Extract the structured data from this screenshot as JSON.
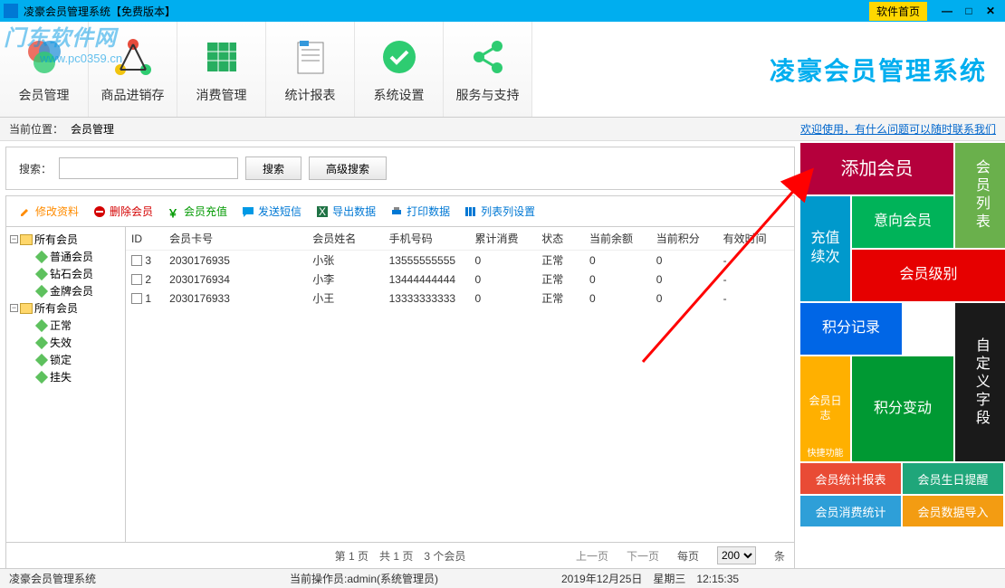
{
  "titlebar": {
    "title": "凌豪会员管理系统【免费版本】",
    "home": "软件首页"
  },
  "watermark": {
    "text": "门东软件网",
    "url": "www.pc0359.cn"
  },
  "toolbar": [
    {
      "label": "会员管理",
      "name": "member-manage"
    },
    {
      "label": "商品进销存",
      "name": "inventory"
    },
    {
      "label": "消费管理",
      "name": "consume"
    },
    {
      "label": "统计报表",
      "name": "report"
    },
    {
      "label": "系统设置",
      "name": "settings"
    },
    {
      "label": "服务与支持",
      "name": "support"
    }
  ],
  "brand": "凌豪会员管理系统",
  "breadcrumb": {
    "label": "当前位置：",
    "path": "会员管理"
  },
  "welcome": "欢迎使用，有什么问题可以随时联系我们",
  "search": {
    "label": "搜索：",
    "btn_search": "搜索",
    "btn_adv": "高级搜索"
  },
  "actions": {
    "edit": "修改资料",
    "delete": "删除会员",
    "recharge": "会员充值",
    "sms": "发送短信",
    "export": "导出数据",
    "print": "打印数据",
    "columns": "列表列设置"
  },
  "tree": [
    {
      "label": "所有会员",
      "children": [
        "普通会员",
        "钻石会员",
        "金牌会员"
      ]
    },
    {
      "label": "所有会员",
      "children": [
        "正常",
        "失效",
        "锁定",
        "挂失"
      ]
    }
  ],
  "table": {
    "headers": [
      "ID",
      "会员卡号",
      "会员姓名",
      "手机号码",
      "累计消费",
      "状态",
      "当前余额",
      "当前积分",
      "有效时间"
    ],
    "rows": [
      {
        "id": "3",
        "card": "2030176935",
        "name": "小张",
        "phone": "13555555555",
        "spend": "0",
        "status": "正常",
        "balance": "0",
        "points": "0",
        "expire": "-"
      },
      {
        "id": "2",
        "card": "2030176934",
        "name": "小李",
        "phone": "13444444444",
        "spend": "0",
        "status": "正常",
        "balance": "0",
        "points": "0",
        "expire": "-"
      },
      {
        "id": "1",
        "card": "2030176933",
        "name": "小王",
        "phone": "13333333333",
        "spend": "0",
        "status": "正常",
        "balance": "0",
        "points": "0",
        "expire": "-"
      }
    ]
  },
  "pager": {
    "summary": "第 1 页　共 1 页　3 个会员",
    "prev": "上一页",
    "next": "下一页",
    "per_label": "每页",
    "per_value": "200",
    "per_unit": "条"
  },
  "tiles": {
    "add": "添加会员",
    "list": "会员列表",
    "intent": "意向会员",
    "recharge": "充值续次",
    "level": "会员级别",
    "points": "积分记录",
    "custom": "自定义字段",
    "log": "会员日志",
    "log_sub": "快捷功能",
    "change": "积分变动",
    "stat": "会员统计报表",
    "birthday": "会员生日提醒",
    "consume_stat": "会员消费统计",
    "import": "会员数据导入"
  },
  "tile_colors": {
    "stat": "#e94b35",
    "birthday": "#1fa67a",
    "consume_stat": "#2e9fd8",
    "import": "#f39c12"
  },
  "statusbar": {
    "app": "凌豪会员管理系统",
    "operator": "当前操作员:admin(系统管理员)",
    "datetime": "2019年12月25日　星期三　12:15:35"
  }
}
